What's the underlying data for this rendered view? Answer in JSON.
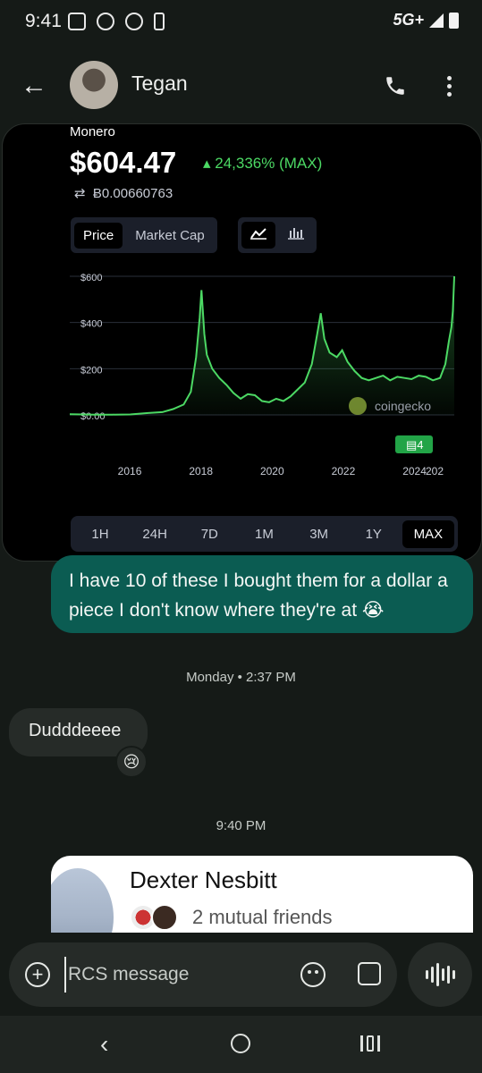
{
  "status_bar": {
    "time": "9:41",
    "network": "5G+"
  },
  "header": {
    "contact_name": "Tegan",
    "back_icon": "arrow-back-icon",
    "call_icon": "phone-icon",
    "more_icon": "more-vert-icon"
  },
  "crypto_card": {
    "coin_name": "Monero",
    "price": "$604.47",
    "change": "24,336% (MAX)",
    "btc_price": "Ƀ0.00660763",
    "tabs": [
      "Price",
      "Market Cap"
    ],
    "active_tab": "Price",
    "view_icons": [
      "line-chart-icon",
      "candlestick-icon"
    ],
    "watermark": "coingecko",
    "badge": "4",
    "ranges": [
      "1H",
      "24H",
      "7D",
      "1M",
      "3M",
      "1Y",
      "MAX"
    ],
    "active_range": "MAX"
  },
  "chart_data": {
    "type": "area",
    "title": "",
    "xlabel": "",
    "ylabel": "",
    "x_ticks": [
      "2016",
      "2018",
      "2020",
      "2022",
      "2024",
      "202"
    ],
    "y_ticks": [
      "$0.00",
      "$200",
      "$400",
      "$600"
    ],
    "ylim": [
      0,
      600
    ],
    "xlim": [
      2014.3,
      2025.1
    ],
    "color": "#4cd964",
    "series": [
      {
        "x": [
          2014.3,
          2015.0,
          2015.5,
          2016.0,
          2016.5,
          2016.9,
          2017.2,
          2017.5,
          2017.7,
          2017.85,
          2017.95,
          2018.0,
          2018.08,
          2018.15,
          2018.3,
          2018.5,
          2018.7,
          2018.9,
          2019.1,
          2019.3,
          2019.5,
          2019.7,
          2019.9,
          2020.1,
          2020.3,
          2020.5,
          2020.7,
          2020.9,
          2021.1,
          2021.25,
          2021.35,
          2021.45,
          2021.6,
          2021.8,
          2021.95,
          2022.1,
          2022.3,
          2022.5,
          2022.7,
          2022.9,
          2023.1,
          2023.3,
          2023.5,
          2023.7,
          2023.9,
          2024.1,
          2024.3,
          2024.5,
          2024.7,
          2024.85,
          2024.95,
          2025.02,
          2025.06,
          2025.1
        ],
        "y": [
          3,
          1,
          1,
          2,
          8,
          12,
          25,
          45,
          100,
          250,
          420,
          540,
          350,
          260,
          200,
          160,
          130,
          95,
          70,
          90,
          85,
          60,
          55,
          70,
          60,
          80,
          110,
          140,
          220,
          350,
          440,
          330,
          270,
          250,
          280,
          230,
          190,
          160,
          150,
          160,
          170,
          150,
          165,
          160,
          155,
          170,
          165,
          150,
          160,
          220,
          320,
          380,
          450,
          600
        ]
      }
    ],
    "grid": true
  },
  "messages": {
    "outgoing_1": "I have 10 of these I bought them for a dollar a piece I don't know where they're at 😭",
    "date_divider": "Monday • 2:37 PM",
    "incoming_1": "Dudddeeee",
    "reaction": "😢",
    "time_divider": "9:40 PM"
  },
  "contact_card": {
    "name": "Dexter Nesbitt",
    "mutual": "2 mutual friends"
  },
  "compose": {
    "placeholder": "RCS message"
  }
}
